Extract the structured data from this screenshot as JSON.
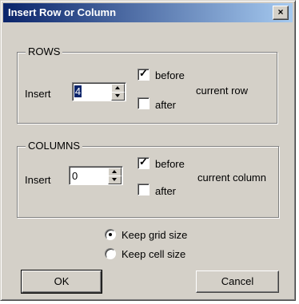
{
  "window": {
    "title": "Insert Row or Column",
    "close_glyph": "×"
  },
  "rows": {
    "legend": "ROWS",
    "insert_label": "Insert",
    "count": "4",
    "before_label": "before",
    "before_checked": true,
    "after_label": "after",
    "after_checked": false,
    "suffix": "current row"
  },
  "columns": {
    "legend": "COLUMNS",
    "insert_label": "Insert",
    "count": "0",
    "before_label": "before",
    "before_checked": true,
    "after_label": "after",
    "after_checked": false,
    "suffix": "current column"
  },
  "resize_mode": {
    "options": [
      "Keep grid size",
      "Keep cell size"
    ],
    "selected": "Keep grid size"
  },
  "buttons": {
    "ok": "OK",
    "cancel": "Cancel"
  },
  "icons": {
    "check": "✓"
  },
  "colors": {
    "title_start": "#0a246a",
    "title_end": "#a6caf0",
    "face": "#d4d0c8"
  }
}
